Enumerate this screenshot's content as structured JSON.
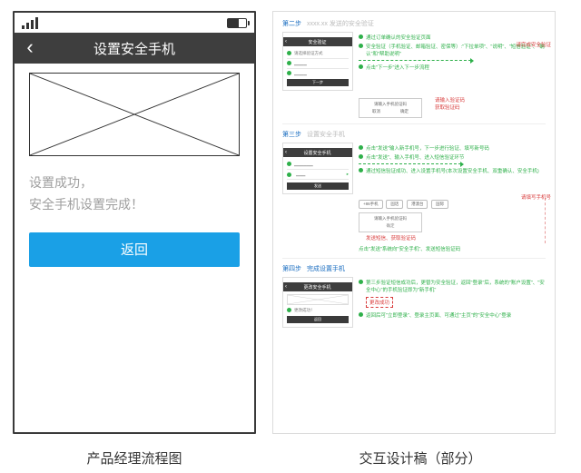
{
  "phone": {
    "titlebar": "设置安全手机",
    "success_line1": "设置成功，",
    "success_line2": "安全手机设置完成！",
    "back_button_label": "返回"
  },
  "captions": {
    "left": "产品经理流程图",
    "right": "交互设计稿（部分）"
  },
  "spec": {
    "section1": {
      "step": "第二步",
      "title": "xxxx.xx 发送的安全验证",
      "mini_title": "安全验证",
      "mini_list_label": "请选择验证方式",
      "mini_footer_btn": "下一步",
      "modal_text": "请输入手机验证码",
      "modal_ok": "确定",
      "modal_cancel": "取消",
      "notes": [
        "通过订单确认的安全验证页面",
        "安全验证（手机验证、邮箱验证、密保等）:\"下拉单项\"、\"说明\"、\"短信验证\"、\"确认\"和\"帮助说明\"",
        "点击\"下一步\"进入下一步流程"
      ],
      "red_side": "请完成安全验证"
    },
    "section2": {
      "step": "第三步",
      "title": "设置安全手机",
      "mini_title": "设置安全手机",
      "mini_footer_btn": "发送",
      "pills": [
        "+86手机",
        "固话",
        "港澳台",
        "国际"
      ],
      "modal_text": "请输入手机验证码",
      "notes": [
        "点击\"发送\"输入新手机号，下一步进行验证、填写新号码",
        "点击\"发送\"、输入手机号、进入短信验证环节",
        "通过短信验证成功、进入设置手机号(本次设置安全手机、双重确认、安全手机)"
      ],
      "red_note": "发送短信、获取验证码",
      "bottom_green": "点击\"发送\"系统向\"安全手机\"、发送短信验证码",
      "red_side": "请填写手机号"
    },
    "section3": {
      "step": "第四步",
      "title": "完成设置手机",
      "mini_title": "更改安全手机",
      "mini_status_label": "更改成功！",
      "notes": [
        "第三步验证短信成功后，更替为安全验证，返回\"登录\"后，系统的\"账户设置\"、\"安全中心\"的手机验证即为\"新手机\"",
        "返回后可\"立即登录\"、登录主页面、可通过\"主页\"的\"安全中心\"登录"
      ],
      "red_side": "更改成功"
    }
  }
}
